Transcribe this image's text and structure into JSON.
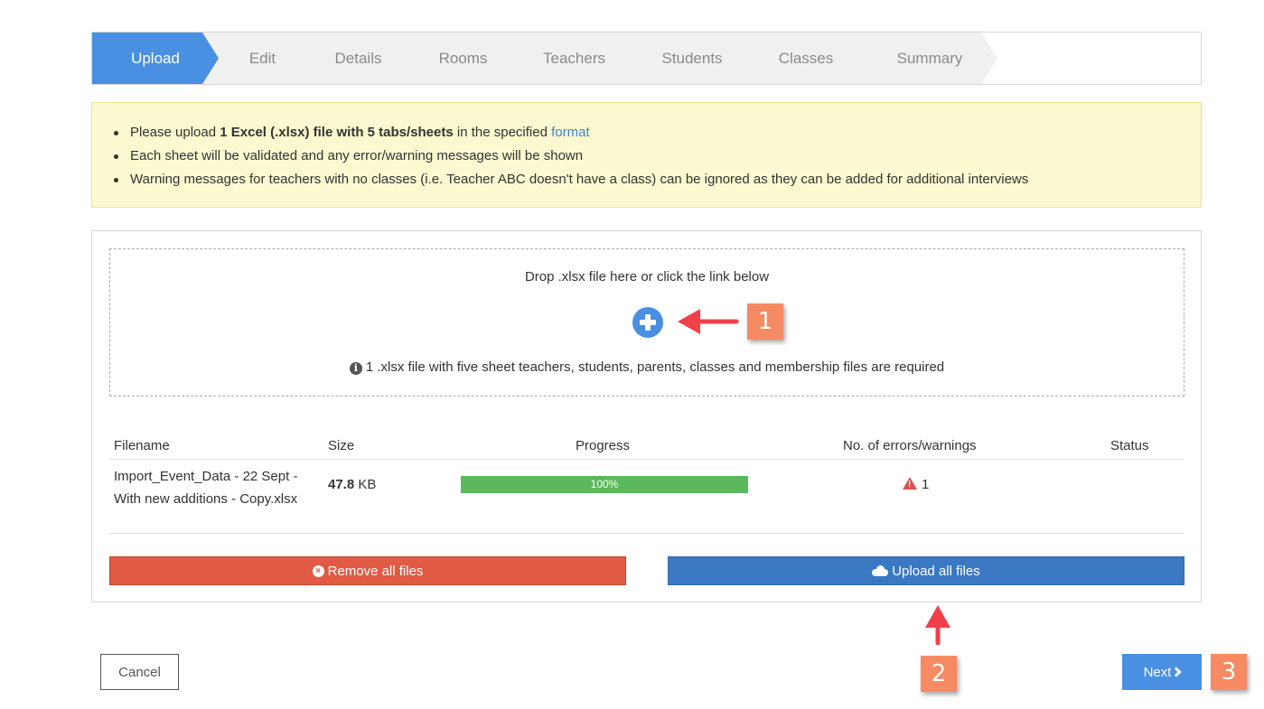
{
  "wizard": {
    "steps": [
      {
        "label": "Upload",
        "active": true
      },
      {
        "label": "Edit"
      },
      {
        "label": "Details"
      },
      {
        "label": "Rooms"
      },
      {
        "label": "Teachers"
      },
      {
        "label": "Students"
      },
      {
        "label": "Classes"
      },
      {
        "label": "Summary"
      }
    ]
  },
  "alert": {
    "line1_pre": "Please upload ",
    "line1_bold": "1 Excel (.xlsx) file with 5 tabs/sheets",
    "line1_mid": " in the specified ",
    "line1_link": "format",
    "line2": "Each sheet will be validated and any error/warning messages will be shown",
    "line3": "Warning messages for teachers with no classes (i.e. Teacher ABC doesn't have a class) can be ignored as they can be added for additional interviews"
  },
  "dropzone": {
    "title": "Drop .xlsx file here or click the link below",
    "note": "1 .xlsx file with five sheet teachers, students, parents, classes and membership files are required",
    "add_icon": "plus-circle-icon"
  },
  "table": {
    "headers": {
      "filename": "Filename",
      "size": "Size",
      "progress": "Progress",
      "errors": "No. of errors/warnings",
      "status": "Status"
    },
    "rows": [
      {
        "filename_line1": "Import_Event_Data - 22 Sept -",
        "filename_line2": "With new additions - Copy.xlsx",
        "size_value": "47.8",
        "size_unit": " KB",
        "progress": "100%",
        "progress_value": 100,
        "warnings": "1",
        "status": ""
      }
    ]
  },
  "buttons": {
    "remove_all": "Remove all files",
    "upload_all": "Upload all files",
    "cancel": "Cancel",
    "next": "Next"
  },
  "callouts": [
    "1",
    "2",
    "3"
  ],
  "colors": {
    "primary": "#4a90e2",
    "danger": "#e05a44",
    "upload": "#3a78c4",
    "success": "#5cb85c",
    "callout": "#f58a63",
    "alert_bg": "#fcf8cf"
  }
}
